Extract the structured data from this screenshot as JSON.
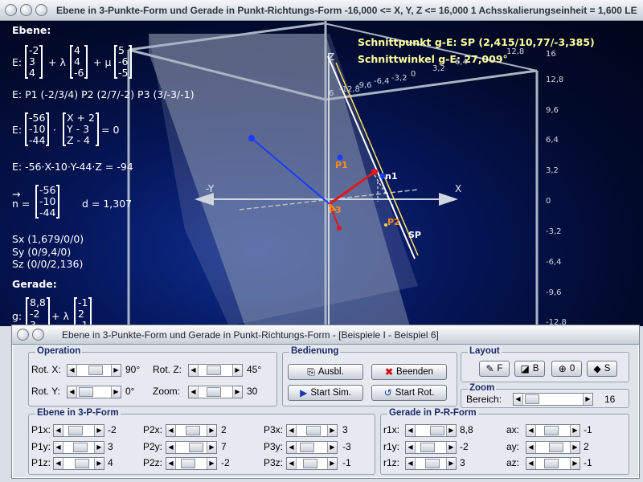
{
  "window": {
    "title": "Ebene in 3-Punkte-Form und Gerade in Punkt-Richtungs-Form   -16,000 <= X, Y, Z <= 16,000    1 Achsskalierungseinheit = 1,600 LE"
  },
  "view": {
    "schnittpunkt": "Schnittpunkt g-E: SP (2,415/10,77/-3,385)",
    "schnittwinkel": "Schnittwinkel g-E: 27,009°",
    "ebene_label": "Ebene:",
    "eq_param": {
      "prefix": "E:",
      "v1": [
        "-2",
        "3",
        "4"
      ],
      "lambda": "+ λ",
      "v2": [
        "4",
        "4",
        "-6"
      ],
      "mu": "+ μ",
      "v3": [
        "5",
        "-6",
        "-5"
      ]
    },
    "points_line": "E: P1 (-2/3/4)    P2 (2/7/-2)    P3 (3/-3/-1)",
    "normal_form": {
      "prefix": "E:",
      "n": [
        "-56",
        "-10",
        "-44"
      ],
      "dot": "·",
      "x": [
        "X + 2",
        "Y - 3",
        "Z - 4"
      ],
      "eq": "= 0"
    },
    "coord_form": "E: -56·X-10·Y-44·Z = -94",
    "normal_vector": {
      "arrow": "→",
      "prefix": "n =",
      "n": [
        "-56",
        "-10",
        "-44"
      ],
      "d": "d = 1,307"
    },
    "sx": "Sx (1,679/0/0)",
    "sy": "Sy (0/9,4/0)",
    "sz": "Sz (0/0/2,136)",
    "gerade_label": "Gerade:",
    "g_form": {
      "prefix": "g:",
      "v1": [
        "8,8",
        "-2",
        "3"
      ],
      "lambda": "+ λ",
      "v2": [
        "-1",
        "2",
        "-1"
      ]
    },
    "axes": {
      "x": "X",
      "y": "-Y",
      "z": "Z"
    },
    "scale_right": [
      "16",
      "12,8",
      "9,6",
      "6,4",
      "3,2",
      "0",
      "-3,2",
      "-6,4",
      "-9,6",
      "-12,8"
    ],
    "scale_top": [
      "6",
      "-12,8",
      "-9,6",
      "-6,4",
      "-3,2",
      "0",
      "3,2",
      "6,4",
      "12,8"
    ],
    "top_right_tick": "12,8",
    "point_labels": {
      "p1": "P1",
      "p2": "P2",
      "p3": "P3",
      "n1": "n1",
      "sp": "SP"
    }
  },
  "panel": {
    "title": "Ebene in 3-Punkte-Form und Gerade in Punkt-Richtungs-Form - [Beispiele I - Beispiel 6]",
    "operation": {
      "title": "Operation",
      "rot_x_label": "Rot. X:",
      "rot_x_value": "90°",
      "rot_y_label": "Rot. Y:",
      "rot_y_value": "0°",
      "rot_z_label": "Rot. Z:",
      "rot_z_value": "45°",
      "zoom_label": "Zoom:",
      "zoom_value": "30"
    },
    "bedienung": {
      "title": "Bedienung",
      "ausbl": "Ausbl.",
      "beenden": "Beenden",
      "start_sim": "Start Sim.",
      "start_rot": "Start Rot."
    },
    "layout": {
      "title": "Layout",
      "f": "F",
      "b": "B",
      "o": "0",
      "s": "S"
    },
    "zoom": {
      "title": "Zoom",
      "bereich_label": "Bereich:",
      "bereich_value": "16"
    },
    "ebene3p": {
      "title": "Ebene in 3-P-Form",
      "rows": [
        {
          "l1": "P1x:",
          "v1": "-2",
          "l2": "P2x:",
          "v2": "2",
          "l3": "P3x:",
          "v3": "3"
        },
        {
          "l1": "P1y:",
          "v1": "3",
          "l2": "P2y:",
          "v2": "7",
          "l3": "P3y:",
          "v3": "-3"
        },
        {
          "l1": "P1z:",
          "v1": "4",
          "l2": "P2z:",
          "v2": "-2",
          "l3": "P3z:",
          "v3": "-1"
        }
      ]
    },
    "gerade": {
      "title": "Gerade in P-R-Form",
      "rows": [
        {
          "l1": "r1x:",
          "v1": "8,8",
          "l2": "ax:",
          "v2": "-1"
        },
        {
          "l1": "r1y:",
          "v1": "-2",
          "l2": "ay:",
          "v2": "2"
        },
        {
          "l1": "r1z:",
          "v1": "3",
          "l2": "az:",
          "v2": "-1"
        }
      ]
    }
  },
  "colors": {
    "accent_yellow": "#ffff9a",
    "plane": "#9aa3b8",
    "normal_red": "#e01818",
    "vector_blue": "#1a3cff",
    "point_orange": "#ff8c1a",
    "group_title": "#1a2a6a"
  }
}
